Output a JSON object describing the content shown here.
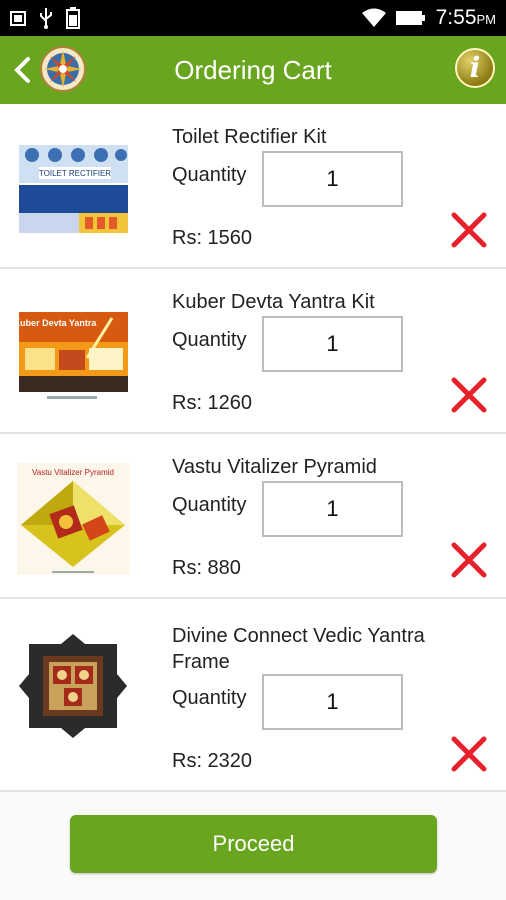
{
  "status_bar": {
    "time": "7:55",
    "ampm": "PM"
  },
  "header": {
    "title": "Ordering Cart",
    "info_glyph": "i"
  },
  "cart": {
    "quantity_label": "Quantity",
    "items": [
      {
        "name": "Toilet Rectifier Kit",
        "quantity": "1",
        "price": "Rs: 1560",
        "thumb_text": "TOILET RECTIFIER"
      },
      {
        "name": "Kuber Devta Yantra Kit",
        "quantity": "1",
        "price": "Rs: 1260",
        "thumb_text": "Kuber Devta Yantra"
      },
      {
        "name": "Vastu Vitalizer Pyramid",
        "quantity": "1",
        "price": "Rs: 880",
        "thumb_text": "Vastu Vitalizer Pyramid"
      },
      {
        "name": "Divine Connect Vedic Yantra Frame",
        "quantity": "1",
        "price": "Rs: 2320",
        "thumb_text": ""
      }
    ]
  },
  "footer": {
    "proceed_label": "Proceed"
  },
  "colors": {
    "accent": "#6aa51f",
    "delete": "#e8202a",
    "info": "#a8941f"
  },
  "icons": [
    "usb-icon",
    "battery-icon",
    "wifi-icon",
    "battery-full-icon",
    "back-arrow-icon",
    "compass-logo-icon",
    "info-icon",
    "delete-x-icon"
  ]
}
